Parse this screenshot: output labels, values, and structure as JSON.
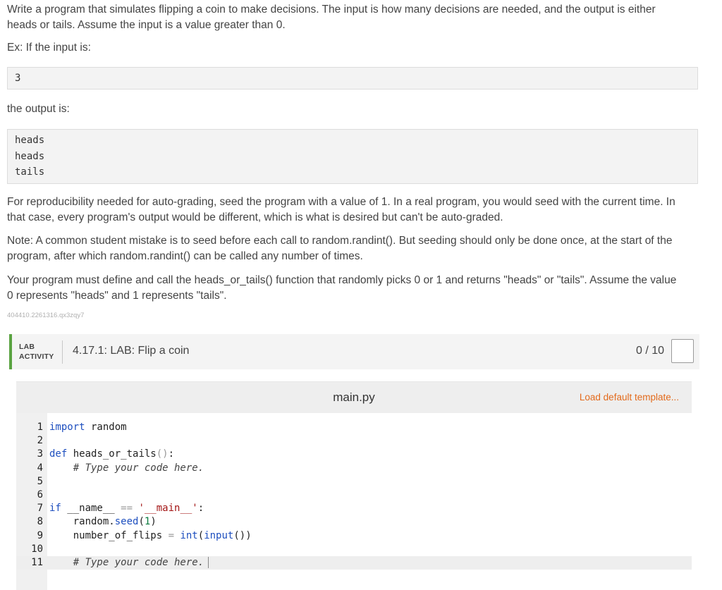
{
  "problem": {
    "intro_line1": "Write a program that simulates flipping a coin to make decisions. The input is how many decisions are needed, and the output is either",
    "intro_line2": "heads or tails. Assume the input is a value greater than 0.",
    "example_label": "Ex: If the input is:",
    "example_input": "3",
    "output_label": "the output is:",
    "example_output": [
      "heads",
      "heads",
      "tails"
    ],
    "seed_line1": "For reproducibility needed for auto-grading, seed the program with a value of 1. In a real program, you would seed with the current time. In",
    "seed_line2": "that case, every program's output would be different, which is what is desired but can't be auto-graded.",
    "note_line1": "Note: A common student mistake is to seed before each call to random.randint(). But seeding should only be done once, at the start of the",
    "note_line2": "program, after which random.randint() can be called any number of times.",
    "define_line1": "Your program must define and call the heads_or_tails() function that randomly picks 0 or 1 and returns \"heads\" or \"tails\". Assume the value",
    "define_line2": "0 represents \"heads\" and 1 represents \"tails\".",
    "identifier": "404410.2261316.qx3zqy7"
  },
  "lab": {
    "type_line1": "LAB",
    "type_line2": "ACTIVITY",
    "title": "4.17.1: LAB: Flip a coin",
    "score": "0 / 10"
  },
  "editor": {
    "file_name": "main.py",
    "load_template": "Load default template...",
    "line_numbers": [
      "1",
      "2",
      "3",
      "4",
      "5",
      "6",
      "7",
      "8",
      "9",
      "10",
      "11"
    ],
    "lines": [
      "import random",
      "",
      "def heads_or_tails():",
      "    # Type your code here.",
      "",
      "",
      "if __name__ == '__main__':",
      "    random.seed(1)",
      "    number_of_flips = int(input())",
      "",
      "    # Type your code here."
    ],
    "colors": {
      "keyword": "#1e4fbf",
      "string": "#a31515",
      "number": "#097a3e",
      "link": "#e36a1c",
      "accent": "#5aa341"
    }
  }
}
